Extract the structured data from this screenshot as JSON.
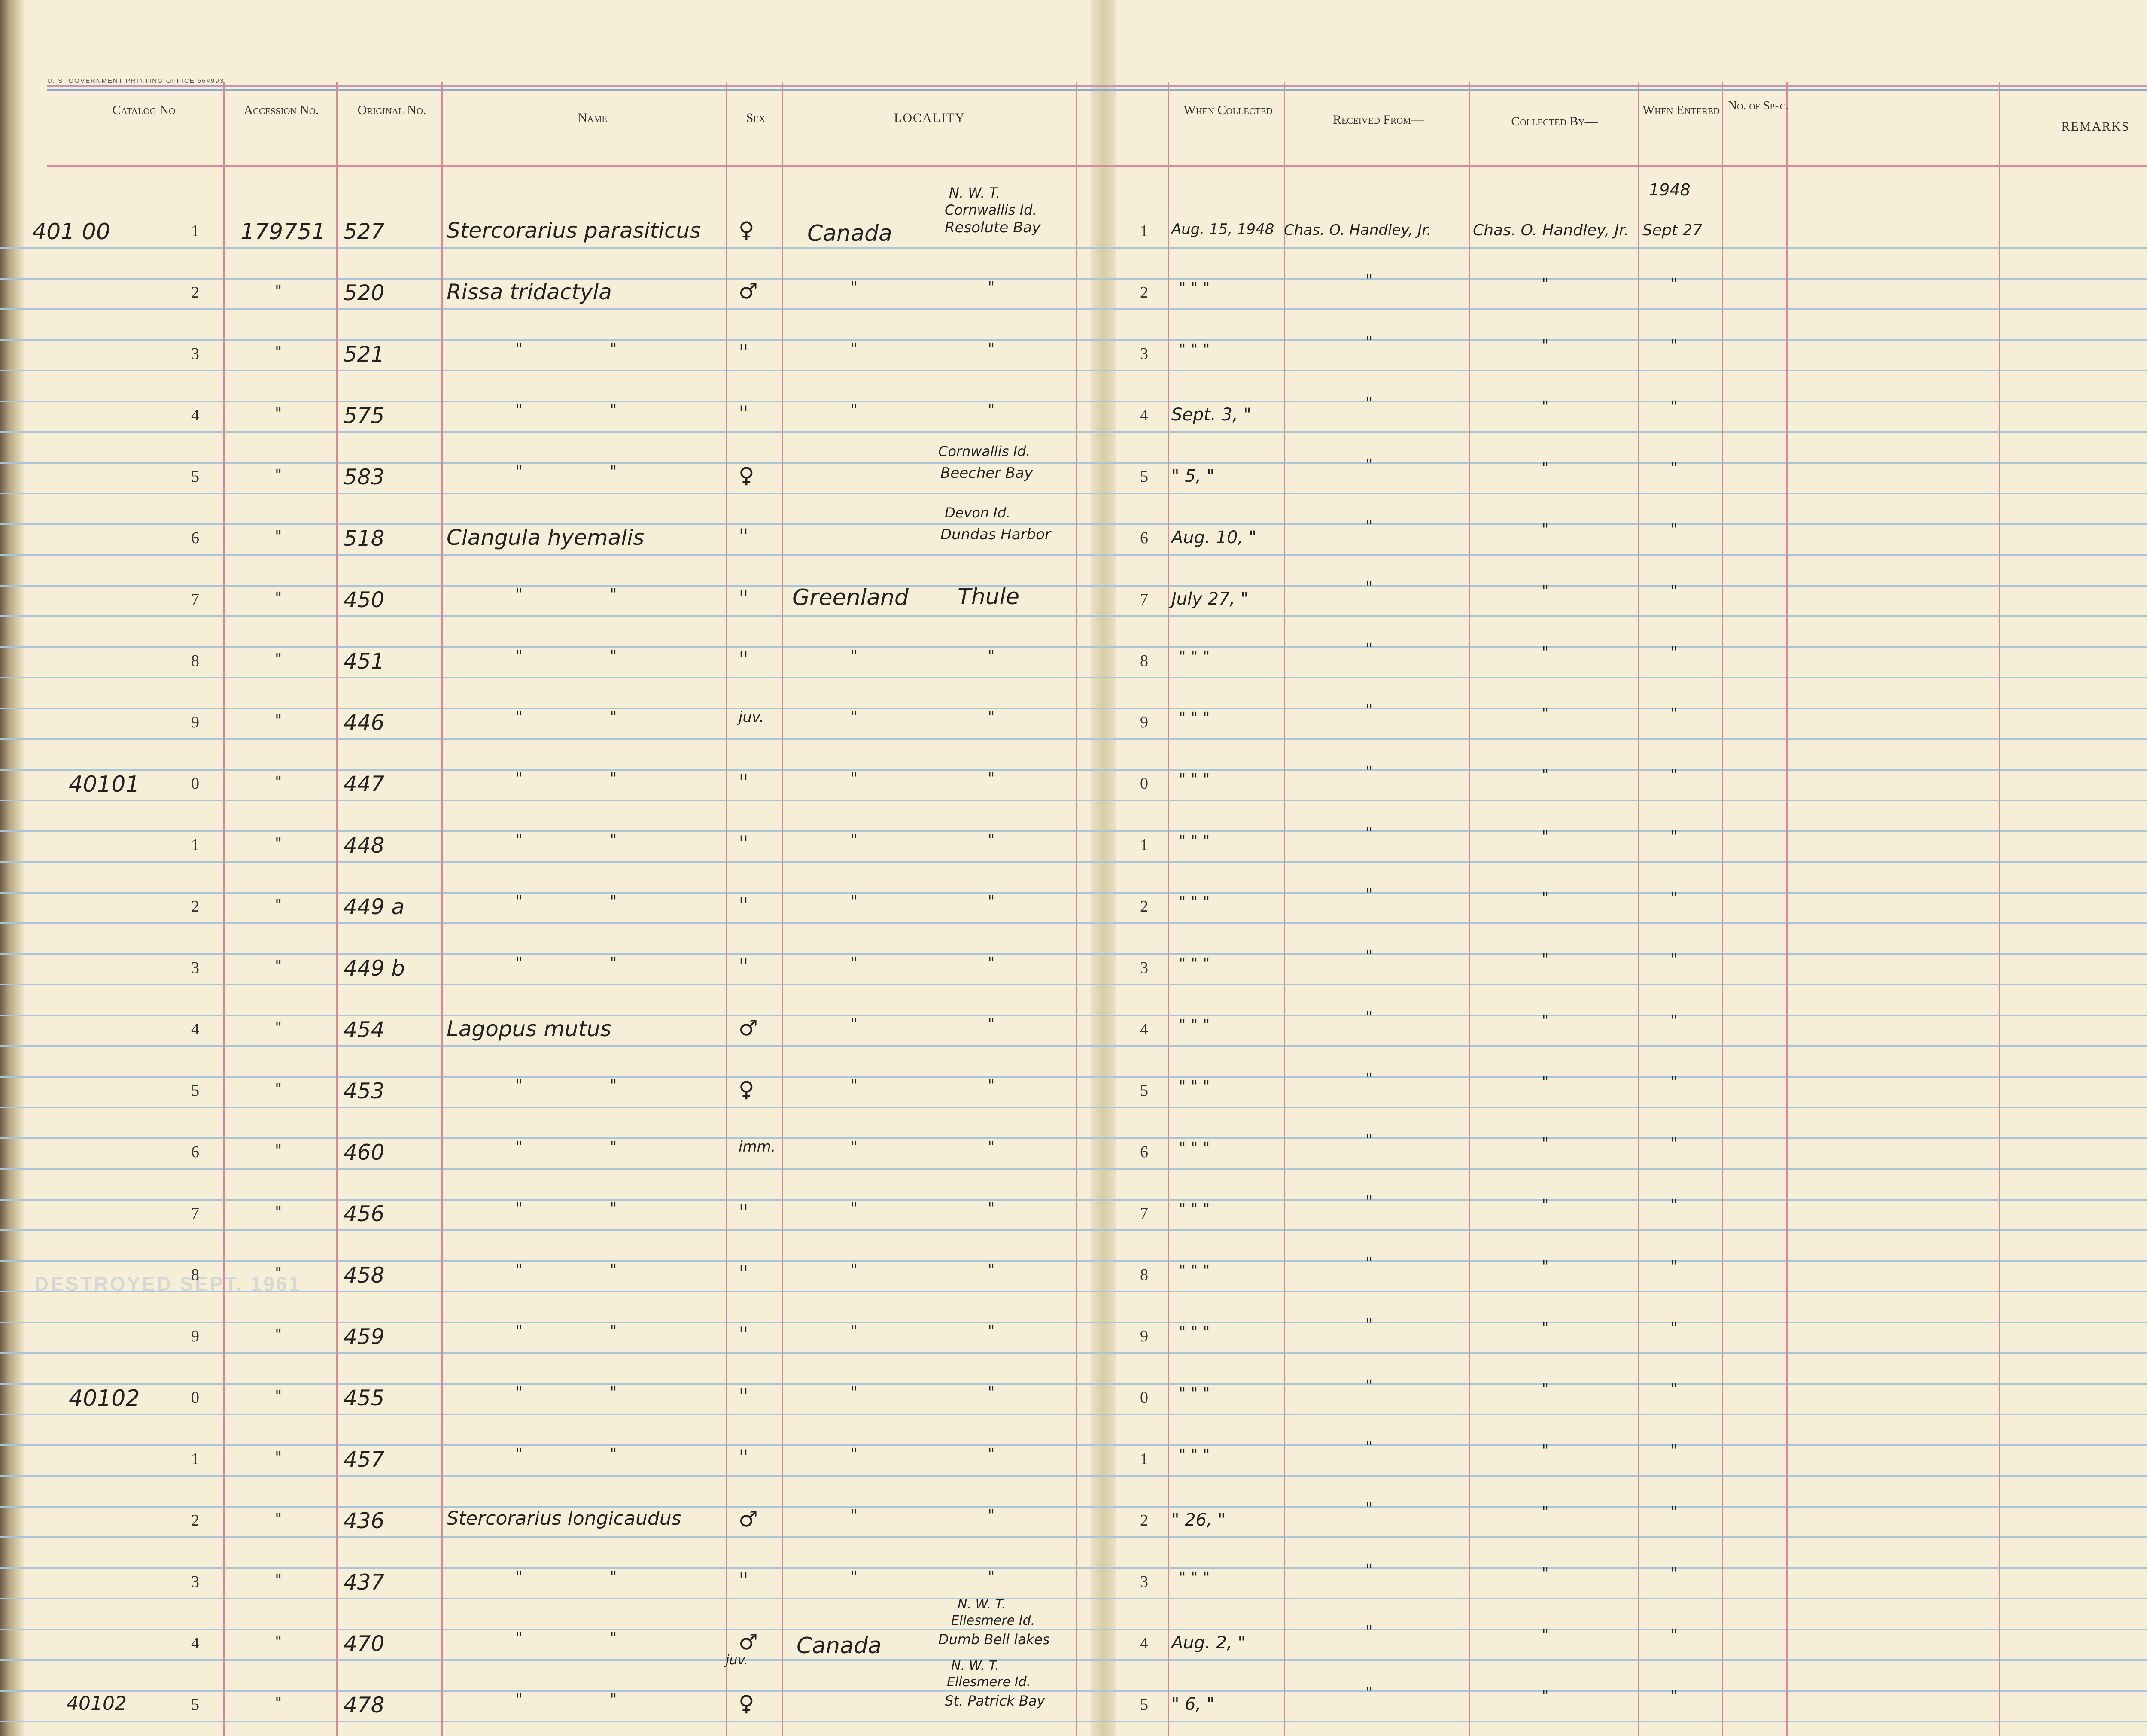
{
  "printer_mark": "U. S. GOVERNMENT PRINTING OFFICE     664993",
  "headers": {
    "catalog": "Catalog No",
    "accession": "Accession No.",
    "original": "Original No.",
    "name": "Name",
    "sex": "Sex",
    "locality": "LOCALITY",
    "when_collected": "When Collected",
    "received_from": "Received From—",
    "collected_by": "Collected By—",
    "when_entered": "When Entered",
    "no_spec": "No. of Spec.",
    "remarks": "REMARKS"
  },
  "catalog_marks": [
    "401 00",
    "40101",
    "40102",
    "40102"
  ],
  "row_digits": [
    "1",
    "2",
    "3",
    "4",
    "5",
    "6",
    "7",
    "8",
    "9",
    "0",
    "1",
    "2",
    "3",
    "4",
    "5",
    "6",
    "7",
    "8",
    "9",
    "0",
    "1",
    "2",
    "3",
    "4",
    "5"
  ],
  "accession_first": "179751",
  "original_numbers": [
    "527",
    "520",
    "521",
    "575",
    "583",
    "518",
    "450",
    "451",
    "446",
    "447",
    "448",
    "449 a",
    "449 b",
    "454",
    "453",
    "460",
    "456",
    "458",
    "459",
    "455",
    "457",
    "436",
    "437",
    "470",
    "478"
  ],
  "names": {
    "r1": "Stercorarius parasiticus",
    "r2": "Rissa tridactyla",
    "r6": "Clangula hyemalis",
    "r14": "Lagopus mutus",
    "r22": "Stercorarius longicaudus"
  },
  "sex": {
    "female": "♀",
    "male": "♂",
    "juv": "juv.",
    "imm": "imm.",
    "ditto": "\""
  },
  "locality": {
    "r1_country": "Canada",
    "r1_region": "N. W. T.",
    "r1_island": "Cornwallis Id.",
    "r1_place": "Resolute Bay",
    "r5_island": "Cornwallis Id.",
    "r5_place": "Beecher Bay",
    "r6_island": "Devon Id.",
    "r6_place": "Dundas Harbor",
    "r7_country": "Greenland",
    "r7_place": "Thule",
    "r24_country": "Canada",
    "r24_region": "N. W. T.",
    "r24_island": "Ellesmere Id.",
    "r24_place": "Dumb Bell lakes",
    "r25_region": "N. W. T.",
    "r25_island": "Ellesmere Id.",
    "r25_place": "St. Patrick Bay"
  },
  "collected_dates": {
    "r1": "Aug. 15, 1948",
    "r4": "Sept. 3, \"",
    "r5": "\" 5, \"",
    "r6": "Aug. 10, \"",
    "r7": "July 27, \"",
    "r22": "\" 26, \"",
    "r24": "Aug. 2, \"",
    "r25": "\" 6, \""
  },
  "received_from": "Chas. O. Handley, Jr.",
  "collected_by": "Chas. O. Handley, Jr.",
  "entered_year": "1948",
  "entered_date": "Sept 27",
  "ditto_mark": "\"",
  "ditto_triple": "\"  \"  \"",
  "faint_stamp": "DESTROYED SEPT. 1961"
}
